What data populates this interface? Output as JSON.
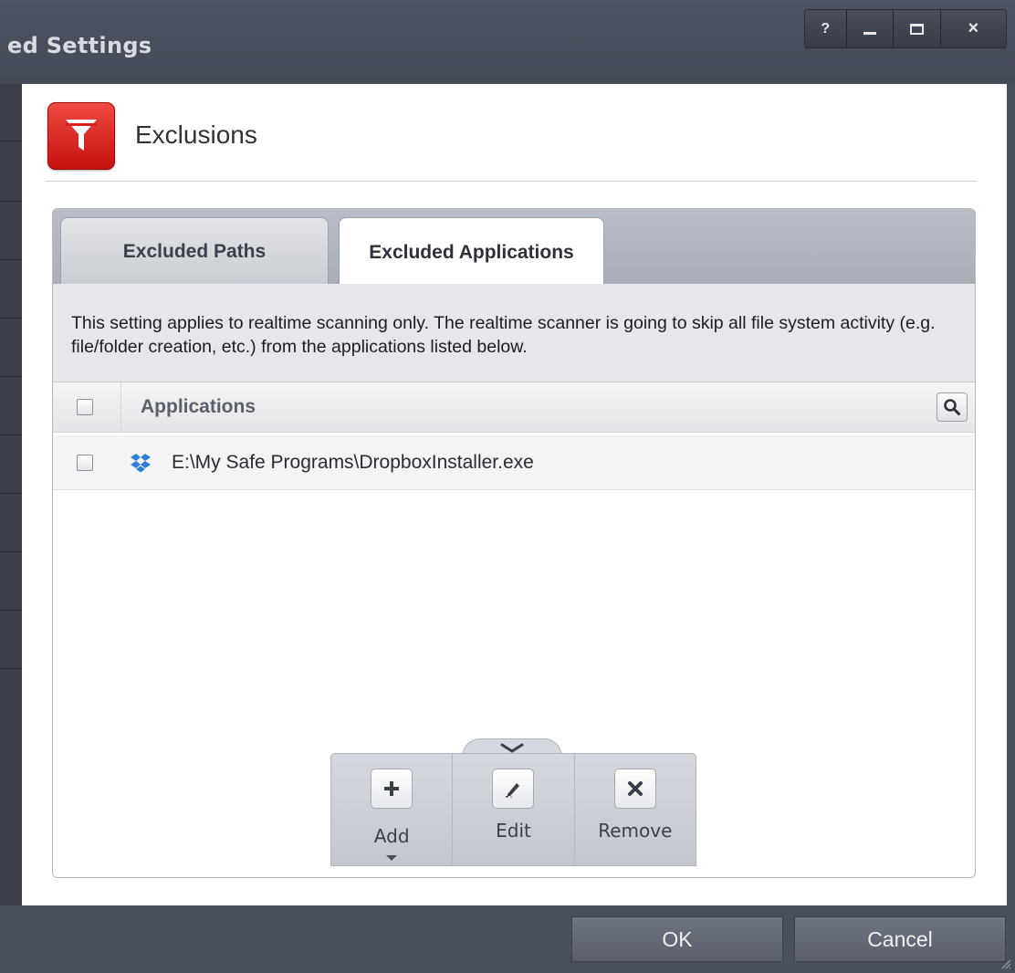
{
  "window": {
    "title": "ed Settings",
    "controls": {
      "help": "?",
      "close": "×"
    }
  },
  "header": {
    "title": "Exclusions",
    "icon": "filter-icon",
    "icon_color": "#d9201a"
  },
  "tabs": [
    {
      "label": "Excluded Paths",
      "active": false
    },
    {
      "label": "Excluded Applications",
      "active": true
    }
  ],
  "description": "This setting applies to realtime scanning only. The realtime scanner is going to skip all file system activity (e.g. file/folder creation, etc.) from the applications listed below.",
  "table": {
    "column_header": "Applications",
    "rows": [
      {
        "path": "E:\\My Safe Programs\\DropboxInstaller.exe",
        "icon": "dropbox-icon",
        "checked": false
      }
    ]
  },
  "actions": {
    "add": "Add",
    "edit": "Edit",
    "remove": "Remove"
  },
  "footer": {
    "ok": "OK",
    "cancel": "Cancel"
  },
  "colors": {
    "dropbox_blue": "#2f7fd8",
    "chrome_dark": "#4a4f5c"
  }
}
